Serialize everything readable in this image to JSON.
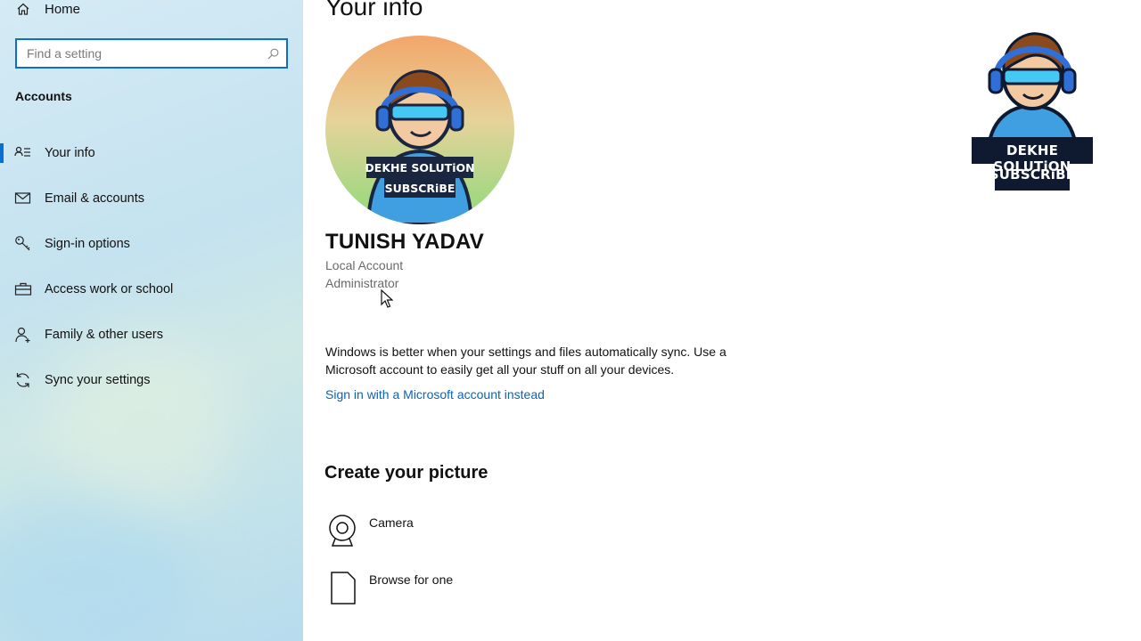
{
  "sidebar": {
    "home_label": "Home",
    "search": {
      "placeholder": "Find a setting",
      "value": ""
    },
    "section_title": "Accounts",
    "items": [
      {
        "label": "Your info",
        "icon": "person-card-icon",
        "active": true
      },
      {
        "label": "Email & accounts",
        "icon": "mail-icon",
        "active": false
      },
      {
        "label": "Sign-in options",
        "icon": "key-icon",
        "active": false
      },
      {
        "label": "Access work or school",
        "icon": "briefcase-icon",
        "active": false
      },
      {
        "label": "Family & other users",
        "icon": "person-add-icon",
        "active": false
      },
      {
        "label": "Sync your settings",
        "icon": "sync-icon",
        "active": false
      }
    ]
  },
  "main": {
    "title": "Your info",
    "user": {
      "name": "TUNISH YADAV",
      "account_type": "Local Account",
      "role": "Administrator"
    },
    "avatar_text": {
      "line1": "DEKHE SOLUTiON",
      "line2": "SUBSCRiBE"
    },
    "sync_message": "Windows is better when your settings and files automatically sync. Use a Microsoft account to easily get all your stuff on all your devices.",
    "ms_link": "Sign in with a Microsoft account instead",
    "create_picture": {
      "title": "Create your picture",
      "options": [
        {
          "label": "Camera",
          "icon": "webcam-icon"
        },
        {
          "label": "Browse for one",
          "icon": "document-icon"
        }
      ]
    }
  },
  "channel_logo": {
    "line1": "DEKHE SOLUTiON",
    "line2": "SUBSCRiBE"
  },
  "colors": {
    "accent": "#0a6fce",
    "link": "#0a64b8",
    "secondary_text": "#6b6b6b"
  }
}
